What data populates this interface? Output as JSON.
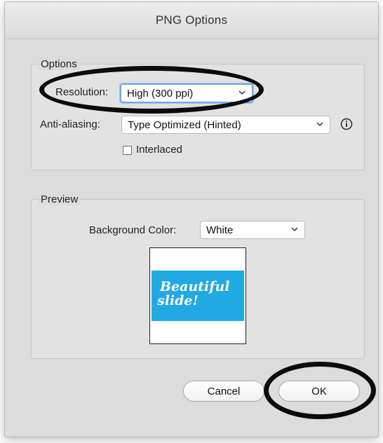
{
  "dialog": {
    "title": "PNG Options"
  },
  "options_group": {
    "label": "Options",
    "resolution": {
      "label": "Resolution:",
      "value": "High (300 ppi)"
    },
    "anti_aliasing": {
      "label": "Anti-aliasing:",
      "value": "Type Optimized (Hinted)"
    },
    "interlaced": {
      "label": "Interlaced",
      "checked": false
    },
    "info_icon": "info-icon"
  },
  "preview_group": {
    "label": "Preview",
    "background_color": {
      "label": "Background Color:",
      "value": "White"
    },
    "slide": {
      "line1": "Beautiful",
      "line2": "slide!",
      "color": "#21a9e3"
    }
  },
  "buttons": {
    "cancel": "Cancel",
    "ok": "OK"
  },
  "colors": {
    "dialog_bg": "#dcdcdc",
    "focus_ring": "#6ea7ea",
    "annotation": "#0b0b0b"
  }
}
